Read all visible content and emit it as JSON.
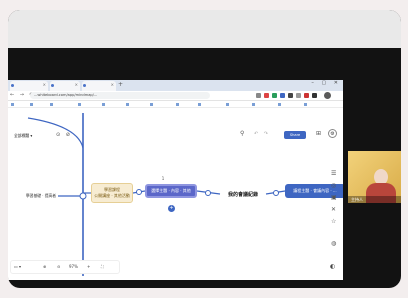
{
  "browser": {
    "tabs": [
      "",
      "",
      ""
    ],
    "url": "...whiteboard.com/app/mindmap/...",
    "window_controls": "– ▢ ✕"
  },
  "mindmap": {
    "top_left_node": "全部標題 ▾",
    "left_leaf": "學習基礎 · 提高者",
    "left_branch_line1": "學習課程",
    "left_branch_line2": "公開講座 · 其他活動",
    "selected_node": "選擇主題 · 內容 · 其他",
    "center_node": "我的會議紀錄",
    "right_node": "議程主題 · 會議內容 · ...",
    "marker": "1"
  },
  "toolbar": {
    "share_label": "Share",
    "zoom_percent": "97%"
  },
  "camera": {
    "label": "主持人"
  },
  "colors": {
    "accent": "#3e66c2",
    "selected": "#5b67c9",
    "branch_fill": "#f7ecd2"
  }
}
